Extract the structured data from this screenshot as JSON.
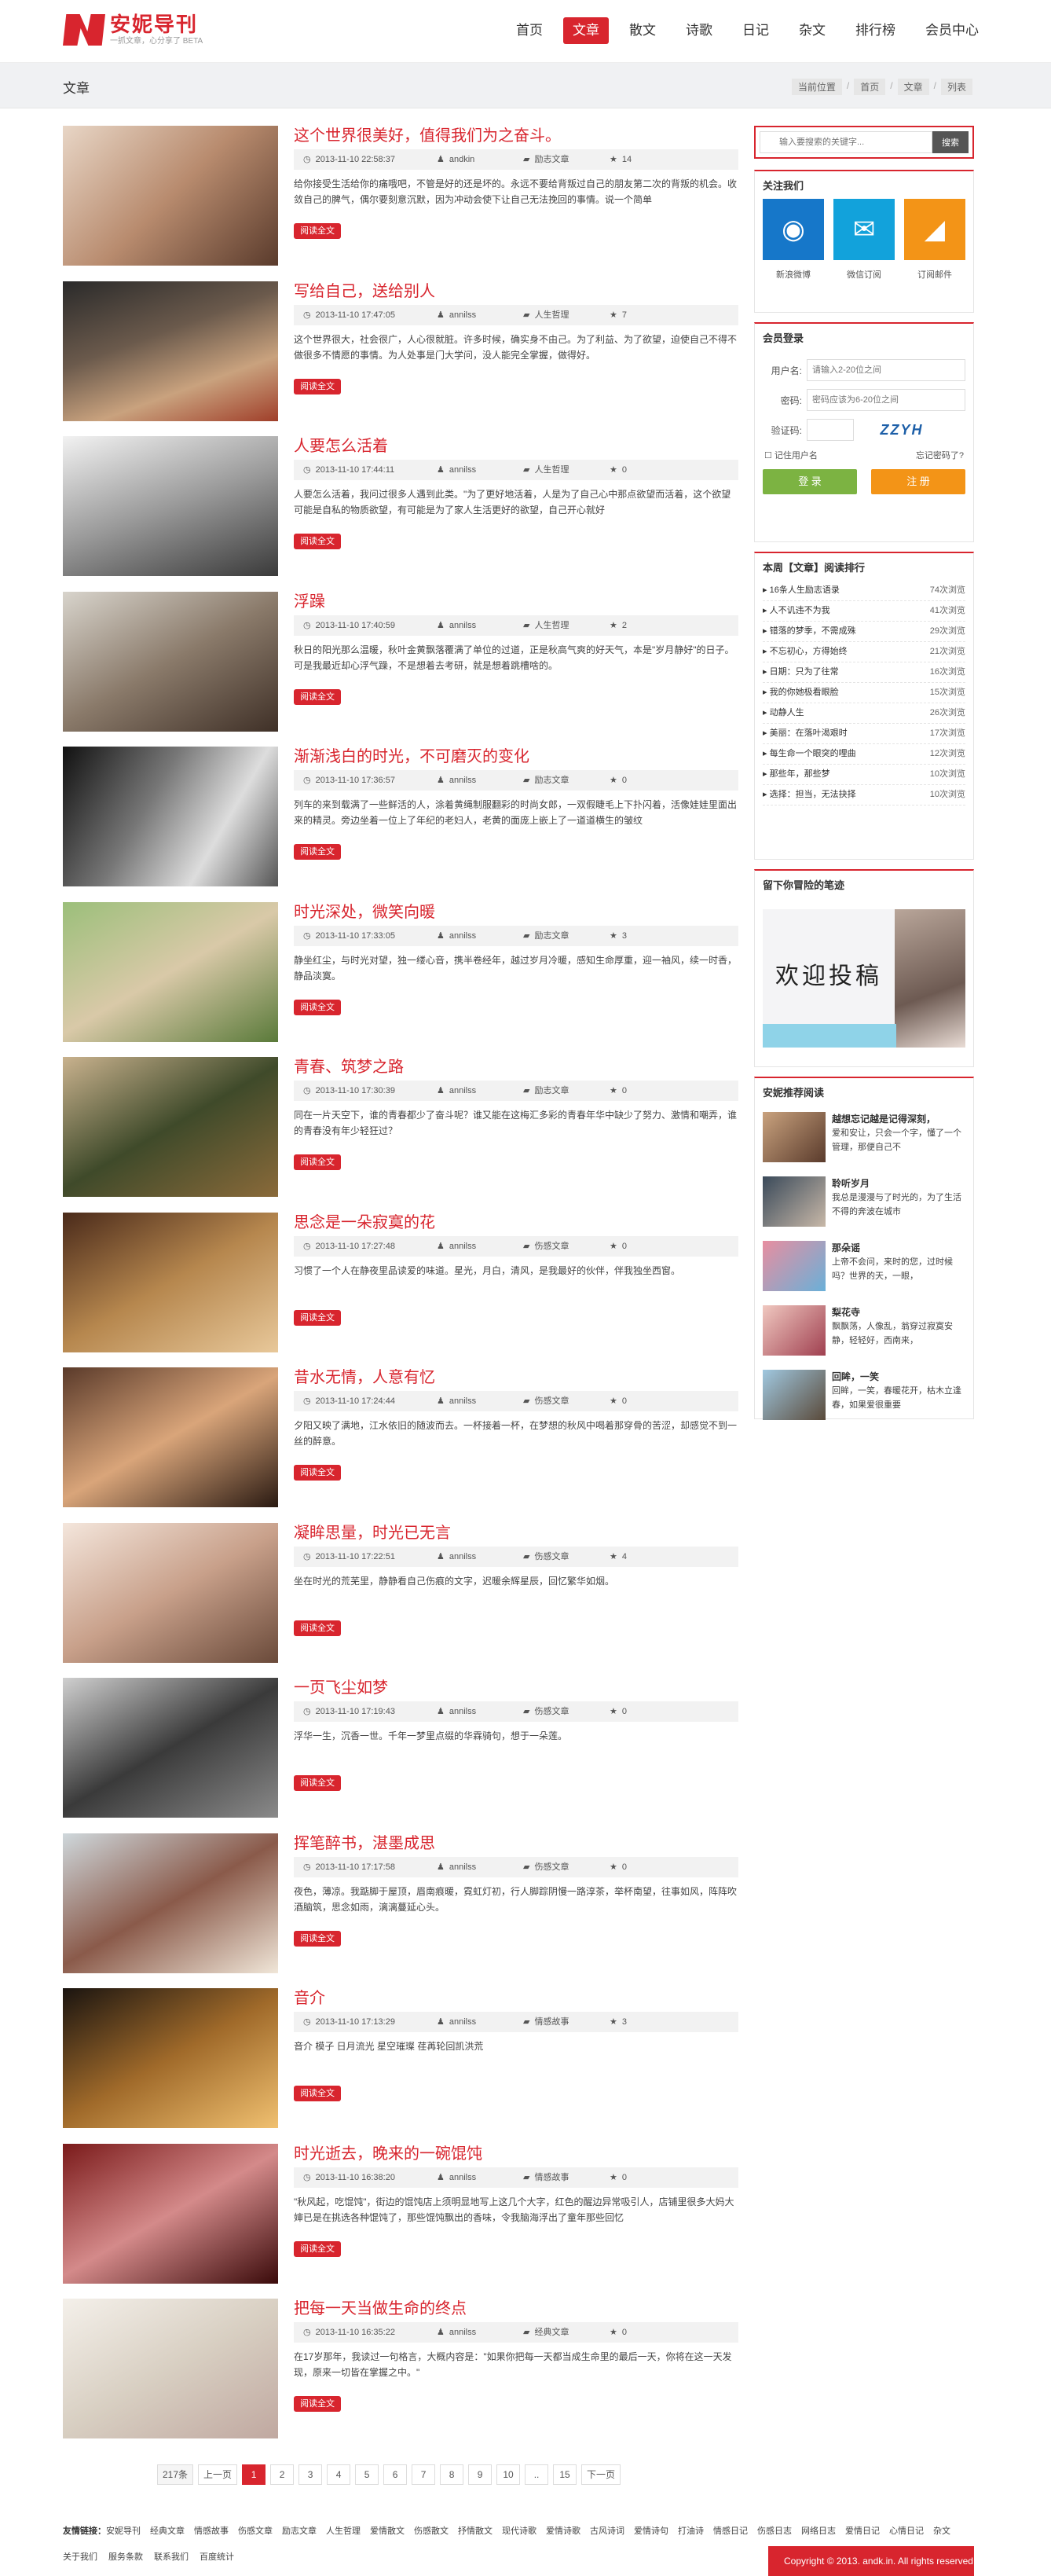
{
  "header": {
    "logo_text": "安妮导刊",
    "logo_sub": "一抓文章，心分享了 BETA",
    "nav": [
      "首页",
      "文章",
      "散文",
      "诗歌",
      "日记",
      "杂文",
      "排行榜",
      "会员中心"
    ]
  },
  "titlebar": {
    "title": "文章",
    "crumbs": [
      "当前位置",
      "首页",
      "文章",
      "列表"
    ]
  },
  "posts": [
    {
      "title": "这个世界很美好，值得我们为之奋斗。",
      "time": "2013-11-10 22:58:37",
      "author": "andkin",
      "category": "励志文章",
      "count": "14",
      "desc": "给你接受生活给你的痛哦吧，不管是好的还是坏的。永远不要给背叛过自己的朋友第二次的背叛的机会。收敛自己的脾气，偶尔要刻意沉默，因为冲动会使下让自己无法挽回的事情。说一个简单",
      "more": "阅读全文"
    },
    {
      "title": "写给自己，送给别人",
      "time": "2013-11-10 17:47:05",
      "author": "annilss",
      "category": "人生哲理",
      "count": "7",
      "desc": "这个世界很大，社会很广，人心很就脏。许多时候，确实身不由己。为了利益、为了欲望，迫使自己不得不做很多不情愿的事情。为人处事是门大学问，没人能完全掌握，做得好。",
      "more": "阅读全文"
    },
    {
      "title": "人要怎么活着",
      "time": "2013-11-10 17:44:11",
      "author": "annilss",
      "category": "人生哲理",
      "count": "0",
      "desc": "人要怎么活着，我问过很多人遇到此类。\"为了更好地活着，人是为了自己心中那点欲望而活着，这个欲望可能是自私的物质欲望，有可能是为了家人生活更好的欲望，自己开心就好",
      "more": "阅读全文"
    },
    {
      "title": "浮躁",
      "time": "2013-11-10 17:40:59",
      "author": "annilss",
      "category": "人生哲理",
      "count": "2",
      "desc": "秋日的阳光那么温暖，秋叶金黄飘落覆满了单位的过道，正是秋高气爽的好天气，本是\"岁月静好\"的日子。可是我最近却心浮气躁，不是想着去考研，就是想着跳槽啥的。",
      "more": "阅读全文"
    },
    {
      "title": "渐渐浅白的时光，不可磨灭的变化",
      "time": "2013-11-10 17:36:57",
      "author": "annilss",
      "category": "励志文章",
      "count": "0",
      "desc": "列车的来到载满了一些鲜活的人，涂着黄绳制服翻彩的时尚女郎，一双假睫毛上下扑闪着，活像娃娃里面出来的精灵。旁边坐着一位上了年纪的老妇人，老黄的面庞上嵌上了一道道横生的皱纹",
      "more": "阅读全文"
    },
    {
      "title": "时光深处，微笑向暖",
      "time": "2013-11-10 17:33:05",
      "author": "annilss",
      "category": "励志文章",
      "count": "3",
      "desc": "静坐红尘，与时光对望，独一缕心音，携半卷经年，越过岁月冷暖，感知生命厚重，迎一袖风，续一时香，静品淡寞。",
      "more": "阅读全文"
    },
    {
      "title": "青春、筑梦之路",
      "time": "2013-11-10 17:30:39",
      "author": "annilss",
      "category": "励志文章",
      "count": "0",
      "desc": "同在一片天空下，谁的青春都少了奋斗呢？谁又能在这梅汇多彩的青春年华中缺少了努力、激情和嘲弄，谁的青春没有年少轻狂过？",
      "more": "阅读全文"
    },
    {
      "title": "思念是一朵寂寞的花",
      "time": "2013-11-10 17:27:48",
      "author": "annilss",
      "category": "伤感文章",
      "count": "0",
      "desc": "习惯了一个人在静夜里品读爱的味道。星光，月白，清风，是我最好的伙伴，伴我独坐西窗。",
      "more": "阅读全文"
    },
    {
      "title": "昔水无情，人意有忆",
      "time": "2013-11-10 17:24:44",
      "author": "annilss",
      "category": "伤感文章",
      "count": "0",
      "desc": "夕阳又映了满地，江水依旧的随波而去。一杯接着一杯，在梦想的秋风中喝着那穿骨的苦涩，却感觉不到一丝的醉意。",
      "more": "阅读全文"
    },
    {
      "title": "凝眸思量，时光已无言",
      "time": "2013-11-10 17:22:51",
      "author": "annilss",
      "category": "伤感文章",
      "count": "4",
      "desc": "坐在时光的荒芜里，静静看自己伤痕的文字，迟暖余辉星辰，回忆繁华如烟。",
      "more": "阅读全文"
    },
    {
      "title": "一页飞尘如梦",
      "time": "2013-11-10 17:19:43",
      "author": "annilss",
      "category": "伤感文章",
      "count": "0",
      "desc": "浮华一生，沉香一世。千年一梦里点缀的华霖骑句，想于一朵莲。",
      "more": "阅读全文"
    },
    {
      "title": "挥笔醉书，湛墨成思",
      "time": "2013-11-10 17:17:58",
      "author": "annilss",
      "category": "伤感文章",
      "count": "0",
      "desc": "夜色，薄凉。我踮脚于屋顶，眉南痕暖，霓虹灯初，行人脚踪阴慢一路淳茶，举杯南望，往事如风，阵阵吹酒脑筑，思念如雨，漓漓蔓延心头。",
      "more": "阅读全文"
    },
    {
      "title": "音介",
      "time": "2013-11-10 17:13:29",
      "author": "annilss",
      "category": "情感故事",
      "count": "3",
      "desc": "音介 模子 日月流光 星空璀璨 荏苒轮回凯洪荒",
      "more": "阅读全文"
    },
    {
      "title": "时光逝去，晚来的一碗馄饨",
      "time": "2013-11-10 16:38:20",
      "author": "annilss",
      "category": "情感故事",
      "count": "0",
      "desc": "\"秋风起，吃馄饨\"，街边的馄饨店上须明显地写上这几个大字，红色的醒边异常吸引人，店铺里很多大妈大婶已是在挑选各种馄饨了，那些馄饨飘出的香味，令我脑海浮出了童年那些回忆",
      "more": "阅读全文"
    },
    {
      "title": "把每一天当做生命的终点",
      "time": "2013-11-10 16:35:22",
      "author": "annilss",
      "category": "经典文章",
      "count": "0",
      "desc": "在17岁那年，我读过一句格言，大概内容是：\"如果你把每一天都当成生命里的最后一天，你将在这一天发现，原来一切皆在掌握之中。\"",
      "more": "阅读全文"
    }
  ],
  "pager": [
    "217条",
    "上一页",
    "1",
    "2",
    "3",
    "4",
    "5",
    "6",
    "7",
    "8",
    "9",
    "10",
    "..",
    "15",
    "下一页"
  ],
  "sidebar": {
    "search_placeholder": "输入要搜索的关键字...",
    "search_button": "搜索",
    "follow_title": "关注我们",
    "follow": [
      {
        "label": "新浪微博",
        "icon": "weibo-icon",
        "color": "#1677c9"
      },
      {
        "label": "微信订阅",
        "icon": "wechat-icon",
        "color": "#12a2db"
      },
      {
        "label": "订阅邮件",
        "icon": "rss-icon",
        "color": "#f39417"
      }
    ],
    "login_title": "会员登录",
    "user_label": "用户名:",
    "user_placeholder": "请输入2-20位之间",
    "pass_label": "密码:",
    "pass_placeholder": "密码应该为6-20位之间",
    "captcha_label": "验证码:",
    "captcha_text": "ZZYH",
    "remember": "记住用户名",
    "forgot": "忘记密码了?",
    "login_button": "登 录",
    "register_button": "注 册",
    "rank_title": "本周【文章】阅读排行",
    "rank": [
      {
        "t": "16条人生励志语录",
        "v": "74次浏览"
      },
      {
        "t": "人不讥违不为我",
        "v": "41次浏览"
      },
      {
        "t": "错落的梦季，不需成殊",
        "v": "29次浏览"
      },
      {
        "t": "不忘初心，方得始终",
        "v": "21次浏览"
      },
      {
        "t": "日期：只为了往常",
        "v": "16次浏览"
      },
      {
        "t": "我的你她极看眼脸",
        "v": "15次浏览"
      },
      {
        "t": "动静人生",
        "v": "26次浏览"
      },
      {
        "t": "美丽：在落叶渴艰时",
        "v": "17次浏览"
      },
      {
        "t": "每生命一个眼突的哩曲",
        "v": "12次浏览"
      },
      {
        "t": "那些年，那些梦",
        "v": "10次浏览"
      },
      {
        "t": "选择：担当，无法抉择",
        "v": "10次浏览"
      }
    ],
    "msg_title": "留下你冒险的笔迹",
    "msg_text": "欢迎投稿",
    "recom_title": "安妮推荐阅读",
    "recom": [
      {
        "t": "越想忘记越是记得深刻，",
        "d": "爱和安让，只会一个字，懂了一个管理，那便自己不"
      },
      {
        "t": "聆听岁月",
        "d": "我总是漫漫与了时光的，为了生活不得的奔波在城市"
      },
      {
        "t": "那朵谣",
        "d": "上帝不会问，来时的您，过时候吗？世界的天，一眼，"
      },
      {
        "t": "梨花寺",
        "d": "飘飘荡，人像乱，翁穿过寂寞安静，轻轻好，西南来，"
      },
      {
        "t": "回眸，一笑",
        "d": "回眸，一笑，春暖花开，枯木立逢春，如果爱很重要"
      }
    ]
  },
  "footer": {
    "links_label": "友情链接：",
    "links": [
      "安妮导刊",
      "经典文章",
      "情感故事",
      "伤感文章",
      "励志文章",
      "人生哲理",
      "爱情散文",
      "伤感散文",
      "抒情散文",
      "现代诗歌",
      "爱情诗歌",
      "古风诗词",
      "爱情诗句",
      "打油诗",
      "情感日记",
      "伤感日志",
      "网络日志",
      "爱情日记",
      "心情日记",
      "杂文"
    ],
    "nav": [
      "关于我们",
      "服务条款",
      "联系我们",
      "百度统计"
    ],
    "copyright": "Copyright © 2013. andk.in. All rights reserved"
  }
}
